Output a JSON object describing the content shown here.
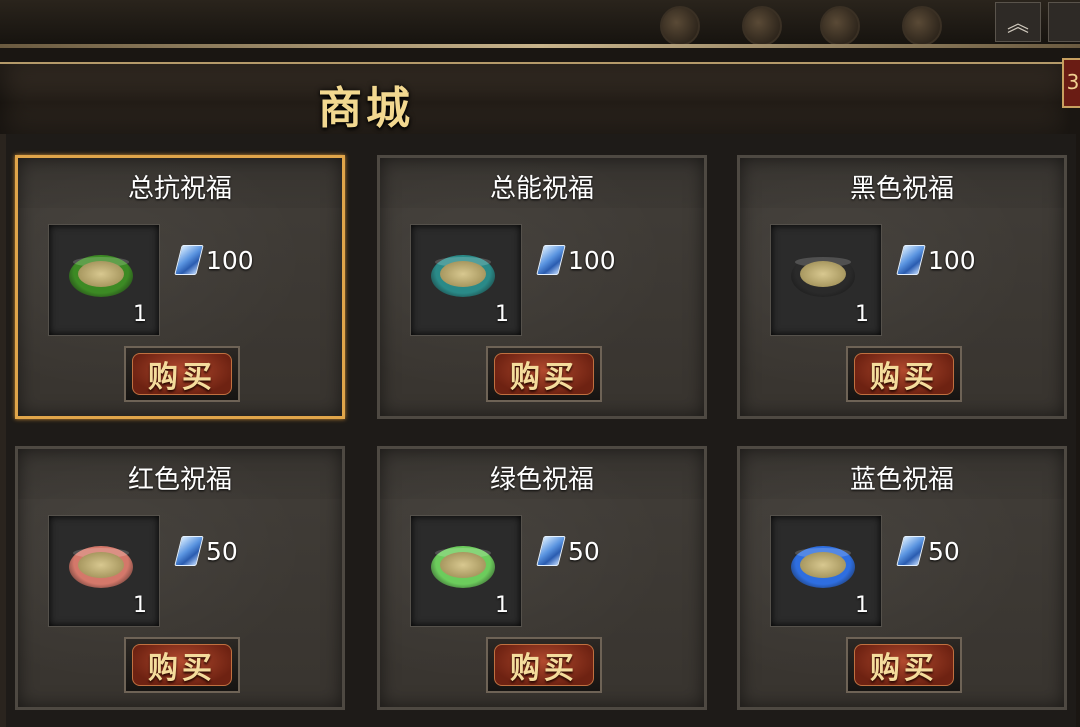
{
  "window": {
    "title": "商城"
  },
  "hud": {
    "collapse_glyph": "︽",
    "close_glyph": "3"
  },
  "shop": {
    "items": [
      {
        "name": "总抗祝福",
        "price": "100",
        "quantity": "1",
        "buy_label": "购买",
        "bowl_color": "#3c8a24",
        "selected": true
      },
      {
        "name": "总能祝福",
        "price": "100",
        "quantity": "1",
        "buy_label": "购买",
        "bowl_color": "#2a8a88",
        "selected": false
      },
      {
        "name": "黑色祝福",
        "price": "100",
        "quantity": "1",
        "buy_label": "购买",
        "bowl_color": "#2a2a2a",
        "selected": false
      },
      {
        "name": "红色祝福",
        "price": "50",
        "quantity": "1",
        "buy_label": "购买",
        "bowl_color": "#d4786a",
        "selected": false
      },
      {
        "name": "绿色祝福",
        "price": "50",
        "quantity": "1",
        "buy_label": "购买",
        "bowl_color": "#6ccc5c",
        "selected": false
      },
      {
        "name": "蓝色祝福",
        "price": "50",
        "quantity": "1",
        "buy_label": "购买",
        "bowl_color": "#2e6ee0",
        "selected": false
      }
    ],
    "currency_icon": "blue-gem-icon"
  },
  "colors": {
    "title_gold": "#f2d890",
    "selected_border": "#e0a54a",
    "buy_button": "#8a2c18"
  }
}
